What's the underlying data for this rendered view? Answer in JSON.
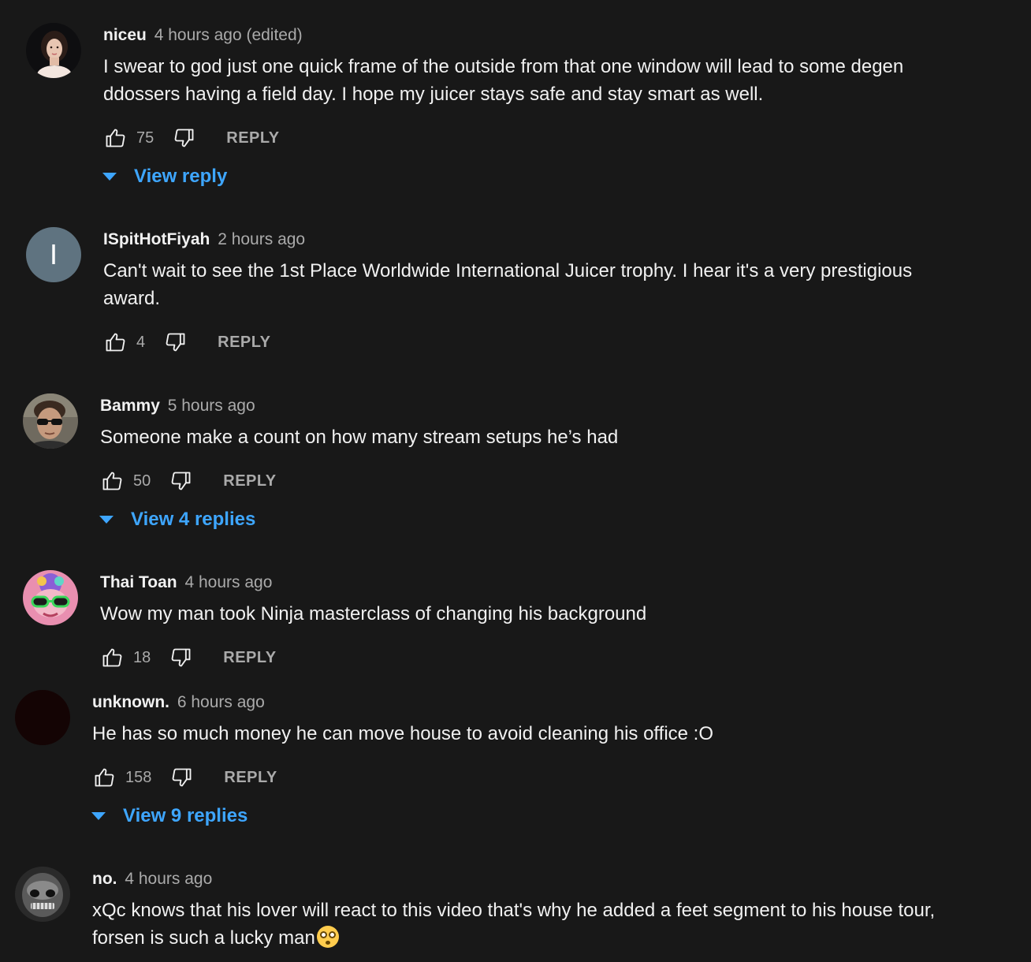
{
  "comments": [
    {
      "author": "niceu",
      "time": "4 hours ago (edited)",
      "text": "I swear to god just one quick frame of the outside from that one window will lead to some degen ddossers having a field day. I hope my juicer stays safe and stay smart as well.",
      "likes": "75",
      "reply_label": "REPLY",
      "view_replies": "View reply",
      "avatar": "photo-avatar-woman"
    },
    {
      "author": "ISpitHotFiyah",
      "time": "2 hours ago",
      "text": "Can't wait to see the 1st Place Worldwide International Juicer trophy.  I hear it's a very prestigious award.",
      "likes": "4",
      "reply_label": "REPLY",
      "avatar_letter": "I",
      "avatar_color": "#5f7380"
    },
    {
      "author": "Bammy",
      "time": "5 hours ago",
      "text": "Someone make a count on how many stream setups he’s had",
      "likes": "50",
      "reply_label": "REPLY",
      "view_replies": "View 4 replies",
      "avatar": "photo-avatar-man-sunglasses"
    },
    {
      "author": "Thai Toan",
      "time": "4 hours ago",
      "text": "Wow my man took Ninja masterclass of changing his background",
      "likes": "18",
      "reply_label": "REPLY",
      "avatar": "cartoon-avatar-sunglasses"
    },
    {
      "author": "unknown.",
      "time": "6 hours ago",
      "text": "He has so much money he can move house to avoid cleaning his office :O",
      "likes": "158",
      "reply_label": "REPLY",
      "view_replies": "View 9 replies",
      "avatar": "dark-avatar"
    },
    {
      "author": "no.",
      "time": "4 hours ago",
      "text": "xQc knows that his lover will react to this video that's why he added a feet segment to his house tour, forsen is such a lucky man",
      "emoji": "flushed-face-emoji",
      "avatar": "grayscale-face-avatar"
    }
  ],
  "colors": {
    "background": "#181818",
    "link": "#3ea6ff",
    "muted": "#aaaaaa",
    "text": "#f1f1f1"
  }
}
